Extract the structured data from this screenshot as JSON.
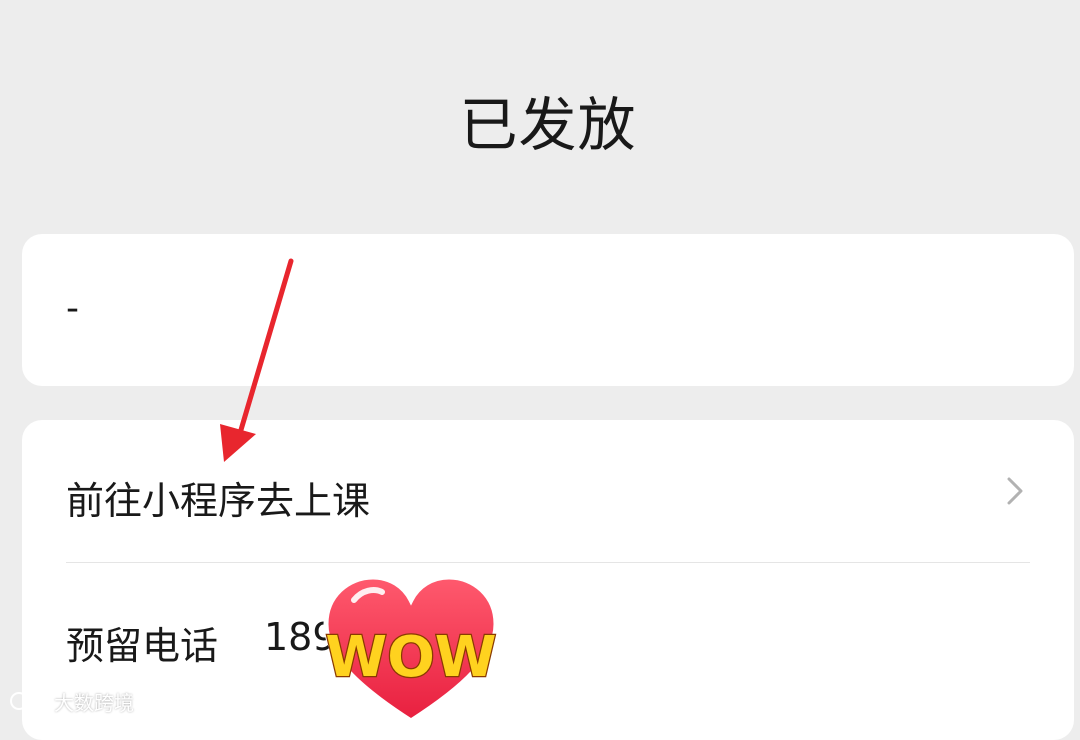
{
  "header": {
    "title": "已发放"
  },
  "info_card": {
    "value": "-"
  },
  "action_card": {
    "link_label": "前往小程序去上课",
    "phone_label": "预留电话",
    "phone_value": "189"
  },
  "sticker": {
    "text": "WOW"
  },
  "watermark": {
    "text": "大数跨境"
  },
  "icons": {
    "chevron": "chevron-right-icon",
    "annotation_arrow": "red-arrow",
    "sticker": "heart-wow-sticker",
    "watermark_logo": "watermark-logo-icon"
  },
  "colors": {
    "background": "#ededed",
    "card": "#ffffff",
    "text": "#191919",
    "arrow": "#e8262e",
    "heart": "#f0324a",
    "sticker_text": "#ffd21f"
  }
}
